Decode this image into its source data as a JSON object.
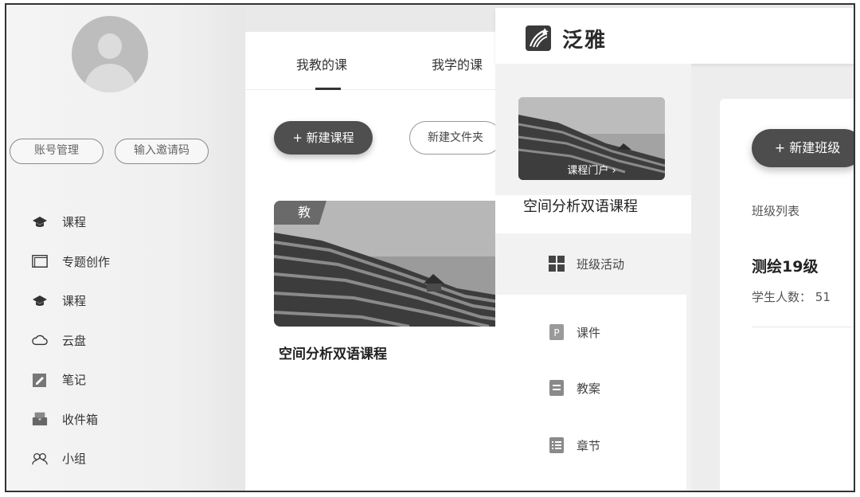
{
  "left_sidebar": {
    "account_button": "账号管理",
    "invite_button": "输入邀请码",
    "menu": [
      {
        "label": "课程",
        "icon": "graduation-cap-icon"
      },
      {
        "label": "专题创作",
        "icon": "window-icon"
      },
      {
        "label": "课程",
        "icon": "graduation-cap-icon"
      },
      {
        "label": "云盘",
        "icon": "cloud-icon"
      },
      {
        "label": "笔记",
        "icon": "note-icon"
      },
      {
        "label": "收件箱",
        "icon": "inbox-icon"
      },
      {
        "label": "小组",
        "icon": "group-icon"
      }
    ]
  },
  "course_panel": {
    "tabs": [
      "我教的课",
      "我学的课"
    ],
    "new_course_button": "+ 新建课程",
    "new_folder_button": "新建文件夹",
    "course_card": {
      "badge": "教",
      "title": "空间分析双语课程"
    }
  },
  "app": {
    "brand": "泛雅",
    "course_portal_link": "课程门户 ›",
    "course_name": "空间分析双语课程",
    "nav": {
      "class_activity": "班级活动",
      "courseware": "课件",
      "lesson_plan": "教案",
      "chapters": "章节"
    },
    "main": {
      "new_class_button": "+ 新建班级",
      "class_list_title": "班级列表",
      "class_name": "测绘19级",
      "students_label": "学生人数：",
      "students_count": "51"
    }
  }
}
